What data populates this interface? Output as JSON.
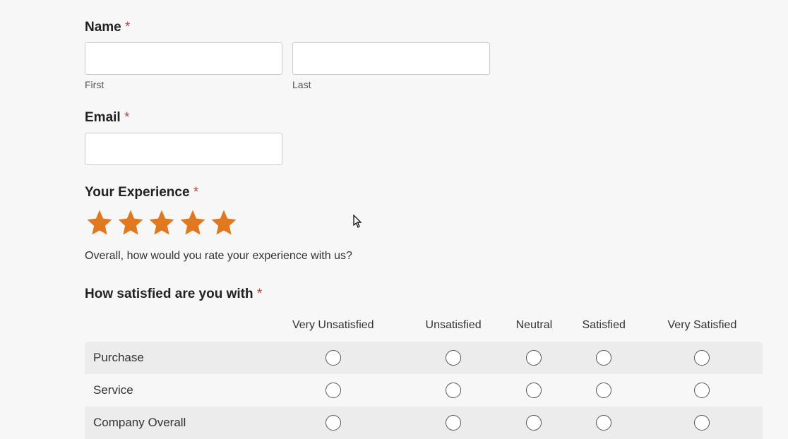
{
  "name": {
    "label": "Name",
    "required": "*",
    "first_sublabel": "First",
    "last_sublabel": "Last",
    "first_value": "",
    "last_value": ""
  },
  "email": {
    "label": "Email",
    "required": "*",
    "value": ""
  },
  "experience": {
    "label": "Your Experience",
    "required": "*",
    "rating": 5,
    "description": "Overall, how would you rate your experience with us?"
  },
  "likert": {
    "label": "How satisfied are you with",
    "required": "*",
    "columns": [
      "Very Unsatisfied",
      "Unsatisfied",
      "Neutral",
      "Satisfied",
      "Very Satisfied"
    ],
    "rows": [
      "Purchase",
      "Service",
      "Company Overall"
    ]
  },
  "colors": {
    "star": "#e0781f",
    "required": "#d63638"
  }
}
